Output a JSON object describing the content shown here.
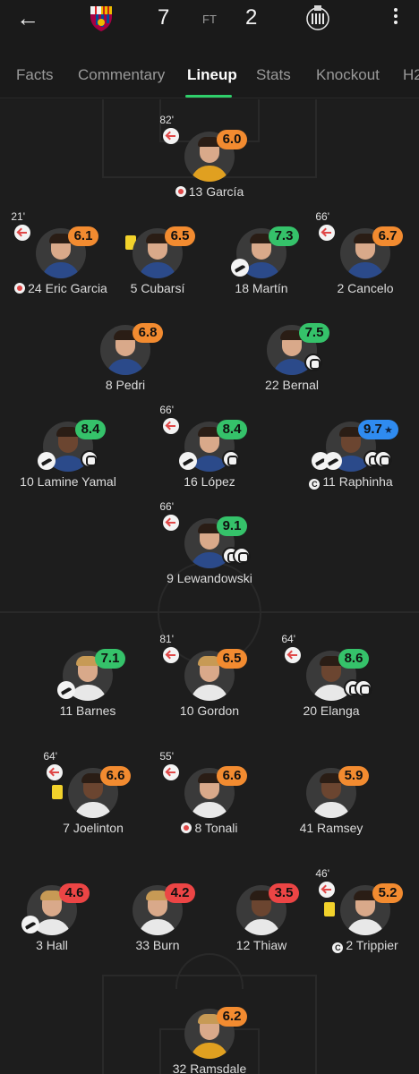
{
  "header": {
    "home_score": "7",
    "status": "FT",
    "away_score": "2",
    "back_icon": "arrow-left-icon",
    "menu_icon": "more-vertical-icon",
    "home_crest_colors": [
      "#a50044",
      "#004d98",
      "#edbb00"
    ],
    "away_crest_colors": [
      "#241f20",
      "#ffffff"
    ]
  },
  "tabs": [
    {
      "label": "Facts"
    },
    {
      "label": "Commentary"
    },
    {
      "label": "Lineup"
    },
    {
      "label": "Stats"
    },
    {
      "label": "Knockout"
    },
    {
      "label": "H2"
    }
  ],
  "active_tab": "Lineup",
  "colors": {
    "rating_orange": "#f28b30",
    "rating_green": "#35c26a",
    "rating_red": "#ec4545",
    "rating_blue": "#2f8bf0",
    "accent": "#2fcf6b"
  },
  "home_team": {
    "players": [
      {
        "name": "13 García",
        "rating": "6.0",
        "minute": "82'"
      },
      {
        "name": "24 Eric Garcia",
        "rating": "6.1",
        "minute": "21'"
      },
      {
        "name": "5 Cubarsí",
        "rating": "6.5",
        "minute": ""
      },
      {
        "name": "18 Martín",
        "rating": "7.3",
        "minute": ""
      },
      {
        "name": "2 Cancelo",
        "rating": "6.7",
        "minute": "66'"
      },
      {
        "name": "8 Pedri",
        "rating": "6.8",
        "minute": ""
      },
      {
        "name": "22 Bernal",
        "rating": "7.5",
        "minute": ""
      },
      {
        "name": "10 Lamine Yamal",
        "rating": "8.4",
        "minute": ""
      },
      {
        "name": "16 López",
        "rating": "8.4",
        "minute": "66'"
      },
      {
        "name": "11 Raphinha",
        "rating": "9.7",
        "minute": ""
      },
      {
        "name": "9 Lewandowski",
        "rating": "9.1",
        "minute": "66'"
      }
    ]
  },
  "away_team": {
    "players": [
      {
        "name": "11 Barnes",
        "rating": "7.1",
        "minute": ""
      },
      {
        "name": "10 Gordon",
        "rating": "6.5",
        "minute": "81'"
      },
      {
        "name": "20 Elanga",
        "rating": "8.6",
        "minute": "64'"
      },
      {
        "name": "7 Joelinton",
        "rating": "6.6",
        "minute": "64'"
      },
      {
        "name": "8 Tonali",
        "rating": "6.6",
        "minute": "55'"
      },
      {
        "name": "41 Ramsey",
        "rating": "5.9",
        "minute": ""
      },
      {
        "name": "3 Hall",
        "rating": "4.6",
        "minute": ""
      },
      {
        "name": "33 Burn",
        "rating": "4.2",
        "minute": ""
      },
      {
        "name": "12 Thiaw",
        "rating": "3.5",
        "minute": ""
      },
      {
        "name": "2 Trippier",
        "rating": "5.2",
        "minute": "46'"
      },
      {
        "name": "32 Ramsdale",
        "rating": "6.2",
        "minute": ""
      }
    ]
  }
}
